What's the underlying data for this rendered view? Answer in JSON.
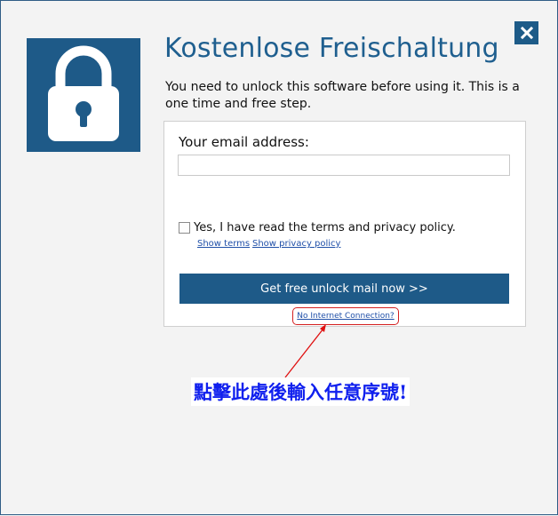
{
  "dialog": {
    "title": "Kostenlose Freischaltung",
    "subtitle": "You need to unlock this software before using it. This is a one time and free step.",
    "close_icon": "close-icon",
    "lock_icon": "padlock-icon",
    "accent_color": "#1e5a88"
  },
  "form": {
    "email_label": "Your email address:",
    "email_value": "",
    "terms_label": "Yes, I have read the terms and privacy policy.",
    "terms_checked": false,
    "show_terms": "Show terms",
    "show_privacy": "Show privacy policy",
    "submit_label": "Get free unlock mail now >>",
    "no_internet": "No Internet Connection?"
  },
  "annotation": {
    "text": "點擊此處後輸入任意序號!",
    "color": "#1020ee",
    "arrow_color": "#e01010"
  }
}
